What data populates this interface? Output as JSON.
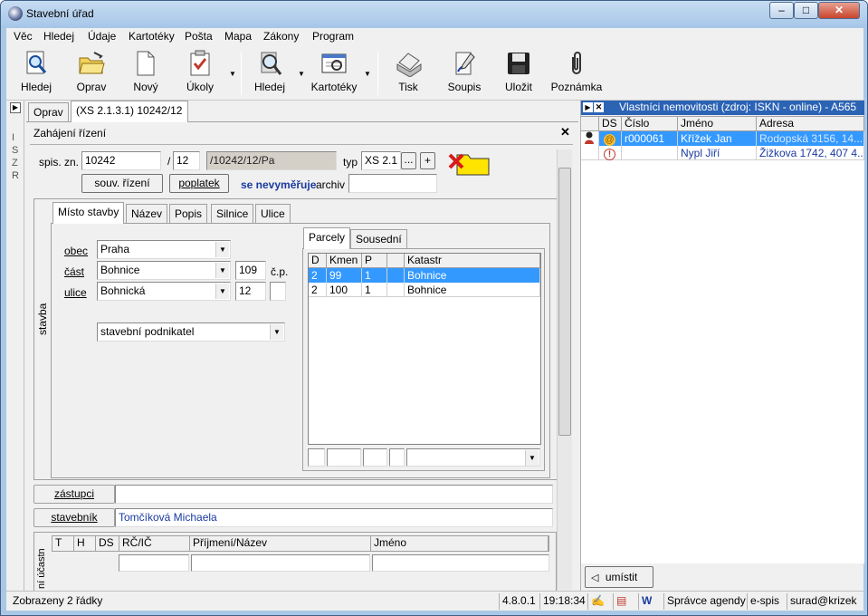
{
  "window": {
    "title": "Stavební úřad",
    "minimize": "–",
    "maximize": "□",
    "close": "✕"
  },
  "menu": [
    "Věc",
    "Hledej",
    "Údaje",
    "Kartotéky",
    "Pošta",
    "Mapa",
    "Zákony",
    "Program"
  ],
  "toolbar": {
    "hledej": "Hledej",
    "oprav": "Oprav",
    "novy": "Nový",
    "ukoly": "Úkoly",
    "hledej2": "Hledej",
    "kartoteky": "Kartotéky",
    "tisk": "Tisk",
    "soupis": "Soupis",
    "ulozit": "Uložit",
    "poznamka": "Poznámka"
  },
  "side_strip": "ISZR",
  "doc_tabs": [
    "Oprav",
    "(XS  2.1.3.1) 10242/12"
  ],
  "panel_title": "Zahájení řízení",
  "close_glyph": "✕",
  "header": {
    "spis_label": "spis. zn.",
    "spis_num": "10242",
    "slash": "/",
    "spis_year": "12",
    "spis_full": "/10242/12/Pa",
    "typ_label": "typ",
    "typ_value": "XS  2.1",
    "ellipsis": "...",
    "plus": "+",
    "souv_button": "souv. řízení",
    "poplatek_button": "poplatek",
    "nevymeruje": "se nevyměřuje",
    "archiv_label": "archiv",
    "archiv_value": ""
  },
  "stavba": {
    "side_label": "stavba",
    "tabs": [
      "Místo stavby",
      "Název",
      "Popis",
      "Silnice",
      "Ulice"
    ],
    "obec_label": "obec",
    "obec_value": "Praha",
    "cast_label": "část",
    "cast_value": "Bohnice",
    "cp_value": "109",
    "cp_label": "č.p.",
    "ulice_label": "ulice",
    "ulice_value": "Bohnická",
    "ulice_num": "12",
    "type_value": "stavební podnikatel",
    "parcel_tabs": [
      "Parcely",
      "Sousední"
    ],
    "parcel_headers": [
      "D",
      "Kmen",
      "P",
      "",
      "Katastr"
    ],
    "parcels": [
      [
        "2",
        "99",
        "1",
        "",
        "Bohnice"
      ],
      [
        "2",
        "100",
        "1",
        "",
        "Bohnice"
      ]
    ]
  },
  "zastupci_label": "zástupci",
  "zastupci_value": "",
  "stavebnik_label": "stavebník",
  "stavebnik_value": "Tomčíková Michaela",
  "ucastnici": {
    "side_label": "ní účastn",
    "headers": [
      "T",
      "H",
      "DS",
      "RČ/IČ",
      "Příjmení/Název",
      "Jméno"
    ]
  },
  "owners": {
    "title": "Vlastníci nemovitosti (zdroj: ISKN - online) - A565",
    "headers": [
      "",
      "DS",
      "Číslo",
      "Jméno",
      "Adresa"
    ],
    "rows": [
      {
        "ds": "@",
        "cislo": "r000061",
        "jmeno": "Křížek Jan",
        "adresa": "Rodopská 3156, 14..."
      },
      {
        "ds": "!",
        "cislo": "",
        "jmeno": "Nypl Jiří",
        "adresa": "Žižkova 1742, 407 4..."
      }
    ],
    "umistit": "umístit"
  },
  "status": {
    "main": "Zobrazeny 2 řádky",
    "version": "4.8.0.1",
    "time": "19:18:34",
    "agenda": "Správce agendy",
    "espis": "e-spis",
    "user": "surad@krizek"
  },
  "colors": {
    "selection": "#3399ff",
    "owners_header": "#2b63b5",
    "link_blue": "#1a3aa0"
  }
}
